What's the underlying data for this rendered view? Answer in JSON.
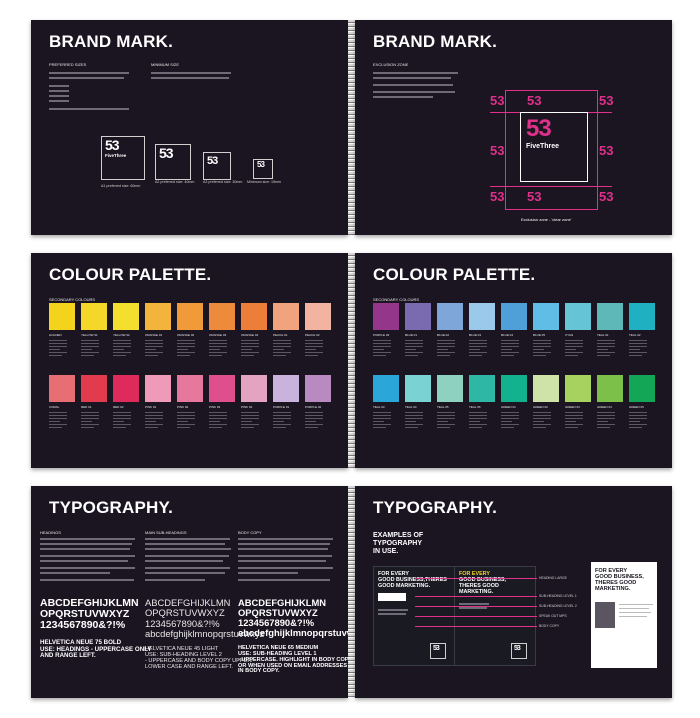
{
  "colors": {
    "page": "#1b1522",
    "accent": "#e0308a",
    "yellow": "#f6d22a"
  },
  "brand_left": {
    "title": "BRAND MARK.",
    "sub_preferred": "PREFERRED SIZES",
    "sub_minimum": "MINIMUM SIZE",
    "logo_number": "53",
    "logo_name": "FiveThree",
    "captions": [
      "A1 preferred size: 60mm",
      "A2 preferred size: 40mm",
      "A3 preferred size: 30mm",
      "Minimum size: 15mm"
    ]
  },
  "brand_right": {
    "title": "BRAND MARK.",
    "sub_exclusion": "EXCLUSION ZONE",
    "logo_number": "53",
    "logo_name": "FiveThree",
    "caption": "Exclusion zone - 'clear zone'"
  },
  "palette_left": {
    "title": "COLOUR PALETTE.",
    "sub": "SECONDARY COLOURS",
    "row1": [
      {
        "name": "GOLDEN",
        "color": "#f3d31c"
      },
      {
        "name": "YELLOW 01",
        "color": "#f5d72a"
      },
      {
        "name": "YELLOW 02",
        "color": "#f4df2e"
      },
      {
        "name": "ORANGE 01",
        "color": "#f2b43a"
      },
      {
        "name": "ORANGE 02",
        "color": "#f09a3a"
      },
      {
        "name": "ORANGE 03",
        "color": "#ee8a3c"
      },
      {
        "name": "ORANGE 04",
        "color": "#ec7e3a"
      },
      {
        "name": "PEACH 01",
        "color": "#f1a37d"
      },
      {
        "name": "PEACH 02",
        "color": "#f2b4a0"
      }
    ],
    "row2": [
      {
        "name": "CORAL",
        "color": "#e76f74"
      },
      {
        "name": "RED 01",
        "color": "#e23b4e"
      },
      {
        "name": "RED 02",
        "color": "#df2a5c"
      },
      {
        "name": "PINK 01",
        "color": "#ee9ab8"
      },
      {
        "name": "PINK 02",
        "color": "#e6789e"
      },
      {
        "name": "PINK 03",
        "color": "#df4f8d"
      },
      {
        "name": "PINK 04",
        "color": "#e5a3c2"
      },
      {
        "name": "PURPLE 01",
        "color": "#c9b2db"
      },
      {
        "name": "PURPLE 02",
        "color": "#b98ac0"
      }
    ]
  },
  "palette_right": {
    "title": "COLOUR PALETTE.",
    "sub": "SECONDARY COLOURS",
    "row1": [
      {
        "name": "PURPLE 03",
        "color": "#94378a"
      },
      {
        "name": "BLUE 01",
        "color": "#7a6bb0"
      },
      {
        "name": "BLUE 02",
        "color": "#7fa6d9"
      },
      {
        "name": "BLUE 03",
        "color": "#9ac9ec"
      },
      {
        "name": "BLUE 04",
        "color": "#4f9fd8"
      },
      {
        "name": "BLUE 05",
        "color": "#5fbde6"
      },
      {
        "name": "CYAN",
        "color": "#65c4d6"
      },
      {
        "name": "TEAL 01",
        "color": "#5eb8b7"
      },
      {
        "name": "TEAL 02",
        "color": "#1fb0c2"
      }
    ],
    "row2": [
      {
        "name": "TEAL 03",
        "color": "#2aa6d8"
      },
      {
        "name": "TEAL 04",
        "color": "#7ad3d2"
      },
      {
        "name": "TEAL 05",
        "color": "#8fd1c1"
      },
      {
        "name": "TEAL 06",
        "color": "#2fb7a6"
      },
      {
        "name": "GREEN 01",
        "color": "#12b28e"
      },
      {
        "name": "GREEN 02",
        "color": "#cfe3a8"
      },
      {
        "name": "GREEN 03",
        "color": "#a8d25f"
      },
      {
        "name": "GREEN 04",
        "color": "#7cc04a"
      },
      {
        "name": "GREEN 05",
        "color": "#14a657"
      }
    ]
  },
  "type_left": {
    "title": "TYPOGRAPHY.",
    "col1_head": "HEADINGS",
    "col2_head": "MAIN SUB-HEADINGS",
    "col3_head": "BODY COPY",
    "col1_alpha": [
      "ABCDEFGHIJKLMN",
      "OPQRSTUVWXYZ",
      "1234567890&?!%"
    ],
    "col1_caption": [
      "HELVETICA NEUE 75 BOLD",
      "USE: HEADINGS - UPPERCASE ONLY",
      "AND RANGE LEFT."
    ],
    "col2_alpha": [
      "ABCDEFGHIJKLMN",
      "OPQRSTUVWXYZ",
      "1234567890&?!%",
      "abcdefghijklmnopqrstuvwxyz"
    ],
    "col2_caption": [
      "HELVETICA NEUE 45 LIGHT",
      "USE: SUB-HEADING LEVEL 2",
      "- UPPERCASE AND BODY COPY UPPER/",
      "LOWER CASE AND RANGE LEFT."
    ],
    "col3_alpha": [
      "ABCDEFGHIJKLMN",
      "OPQRSTUVWXYZ",
      "1234567890&?!%",
      "abcdefghijklmnopqrstuvwxyz"
    ],
    "col3_caption": [
      "HELVETICA NEUE 65 MEDIUM",
      "USE: SUB-HEADING LEVEL 1",
      "- UPPERCASE. HIGHLIGHT IN BODY COPY,",
      "OR WHEN USED ON EMAIL ADDRESSES",
      "IN BODY COPY."
    ]
  },
  "type_right": {
    "title": "TYPOGRAPHY.",
    "examples_heading": [
      "EXAMPLES OF",
      "TYPOGRAPHY",
      "IN USE."
    ],
    "ad1": [
      "FOR EVERY",
      "GOOD BUSINESS,THERES",
      "GOOD MARKETING."
    ],
    "ad2": [
      "FOR EVERY",
      "GOOD BUSINESS,",
      "THERES GOOD",
      "MARKETING."
    ],
    "ad3": [
      "FOR EVERY",
      "GOOD BUSINESS,",
      "THERES GOOD",
      "MARKETING."
    ],
    "ad_logo": "53",
    "callouts": [
      "HEADING LARGE",
      "SUB-HEADING LEVEL 1",
      "SUB-HEADING LEVEL 2",
      "SPEAK OUT MPS",
      "BODY COPY"
    ]
  }
}
